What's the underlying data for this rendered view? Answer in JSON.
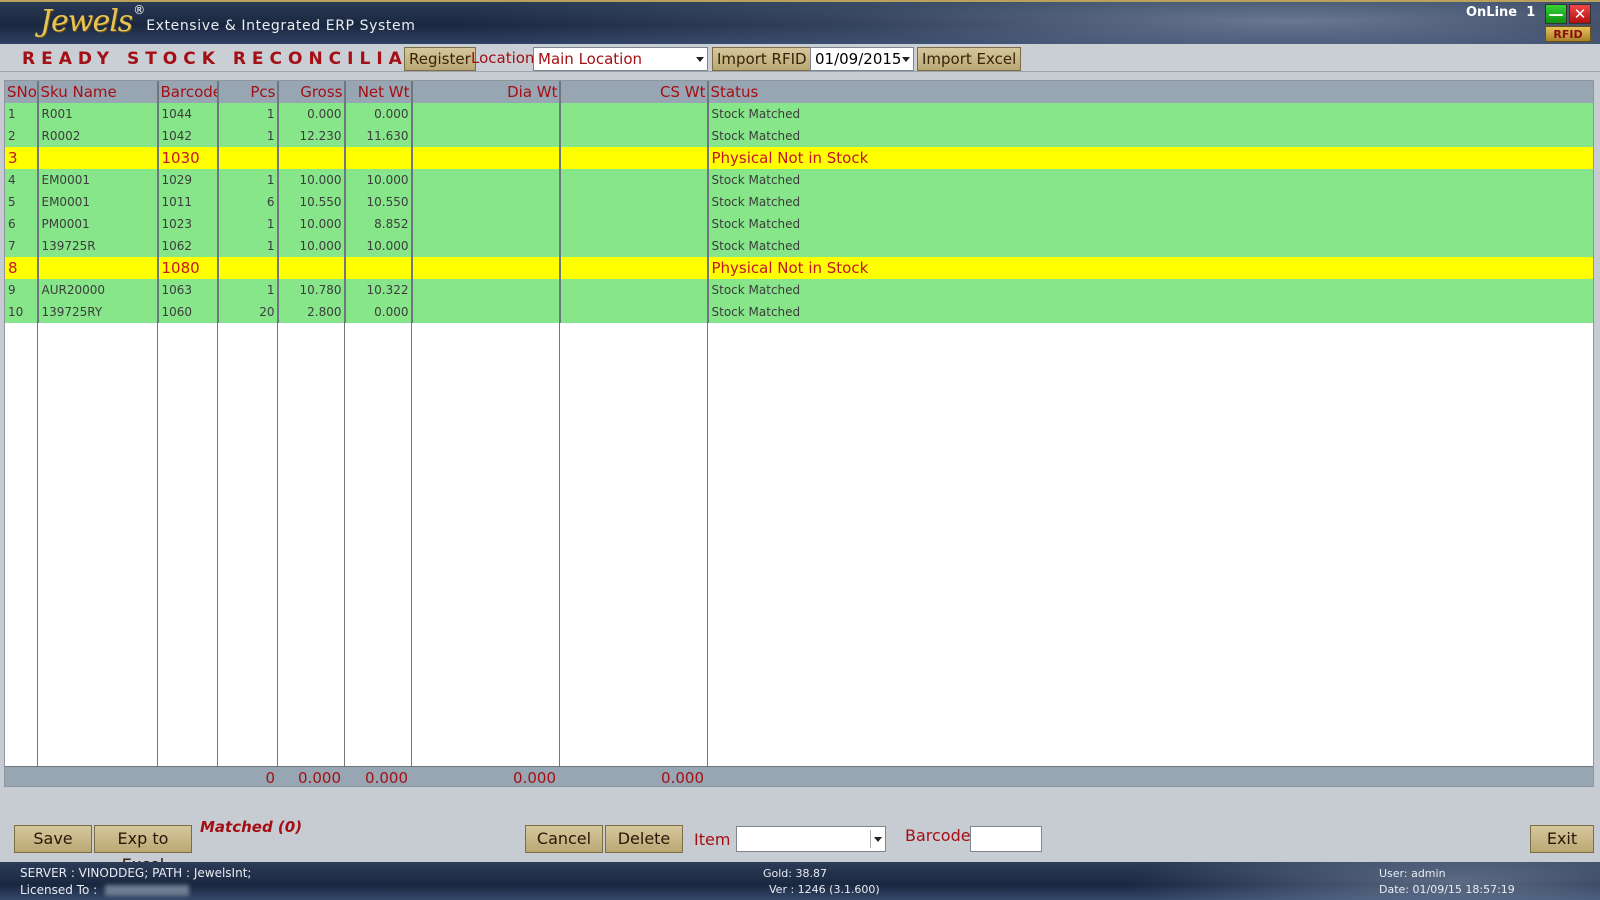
{
  "app": {
    "brand": "Jewels",
    "reg_mark": "®",
    "tagline": "Extensive & Integrated ERP System",
    "online_label": "OnLine",
    "online_count": "1",
    "minimize_glyph": "—",
    "close_glyph": "✕",
    "rfid_badge": "RFID"
  },
  "toolbar": {
    "title": "READY STOCK RECONCILIATION",
    "register_label": "Register",
    "location_label": "Location",
    "location_value": "Main Location",
    "import_rfid_label": "Import RFID",
    "date_value": "01/09/2015",
    "import_excel_label": "Import Excel"
  },
  "grid": {
    "columns": [
      "SNo",
      "Sku Name",
      "Barcode",
      "Pcs",
      "Gross",
      "Net Wt",
      "Dia Wt",
      "CS Wt",
      "Status"
    ],
    "rows": [
      {
        "sno": "1",
        "sku": "R001",
        "barcode": "1044",
        "pcs": "1",
        "gross": "0.000",
        "net": "0.000",
        "dia": "",
        "cs": "",
        "status": "Stock Matched",
        "type": "ok"
      },
      {
        "sno": "2",
        "sku": "R0002",
        "barcode": "1042",
        "pcs": "1",
        "gross": "12.230",
        "net": "11.630",
        "dia": "",
        "cs": "",
        "status": "Stock Matched",
        "type": "ok"
      },
      {
        "sno": "3",
        "sku": "",
        "barcode": "1030",
        "pcs": "",
        "gross": "",
        "net": "",
        "dia": "",
        "cs": "",
        "status": "Physical Not in Stock",
        "type": "warn"
      },
      {
        "sno": "4",
        "sku": "EM0001",
        "barcode": "1029",
        "pcs": "1",
        "gross": "10.000",
        "net": "10.000",
        "dia": "",
        "cs": "",
        "status": "Stock Matched",
        "type": "ok"
      },
      {
        "sno": "5",
        "sku": "EM0001",
        "barcode": "1011",
        "pcs": "6",
        "gross": "10.550",
        "net": "10.550",
        "dia": "",
        "cs": "",
        "status": "Stock Matched",
        "type": "ok"
      },
      {
        "sno": "6",
        "sku": "PM0001",
        "barcode": "1023",
        "pcs": "1",
        "gross": "10.000",
        "net": "8.852",
        "dia": "",
        "cs": "",
        "status": "Stock Matched",
        "type": "ok"
      },
      {
        "sno": "7",
        "sku": "139725R",
        "barcode": "1062",
        "pcs": "1",
        "gross": "10.000",
        "net": "10.000",
        "dia": "",
        "cs": "",
        "status": "Stock Matched",
        "type": "ok"
      },
      {
        "sno": "8",
        "sku": "",
        "barcode": "1080",
        "pcs": "",
        "gross": "",
        "net": "",
        "dia": "",
        "cs": "",
        "status": "Physical Not in Stock",
        "type": "warn"
      },
      {
        "sno": "9",
        "sku": "AUR20000",
        "barcode": "1063",
        "pcs": "1",
        "gross": "10.780",
        "net": "10.322",
        "dia": "",
        "cs": "",
        "status": "Stock Matched",
        "type": "ok"
      },
      {
        "sno": "10",
        "sku": "139725RY",
        "barcode": "1060",
        "pcs": "20",
        "gross": "2.800",
        "net": "0.000",
        "dia": "",
        "cs": "",
        "status": "Stock Matched",
        "type": "ok"
      }
    ],
    "totals": {
      "pcs": "0",
      "gross": "0.000",
      "net": "0.000",
      "dia": "0.000",
      "cs": "0.000"
    }
  },
  "footer": {
    "save_label": "Save",
    "export_label": "Exp to Excel",
    "matched_text": "Matched (0)",
    "cancel_label": "Cancel",
    "delete_label": "Delete",
    "item_label": "Item",
    "item_value": "",
    "barcode_label": "Barcode",
    "barcode_value": "",
    "exit_label": "Exit"
  },
  "status_bar": {
    "server_path": "SERVER : VINODDEG;  PATH : JewelsInt;",
    "licensed_to": "Licensed To :",
    "gold": "Gold: 38.87",
    "version": "Ver : 1246  (3.1.600)",
    "user": "User: admin",
    "date": "Date: 01/09/15 18:57:19"
  },
  "colors": {
    "matched_row": "#87e58a",
    "warn_row": "#ffff00",
    "accent_red": "#a30f14",
    "header_bg": "#98a6b3"
  }
}
